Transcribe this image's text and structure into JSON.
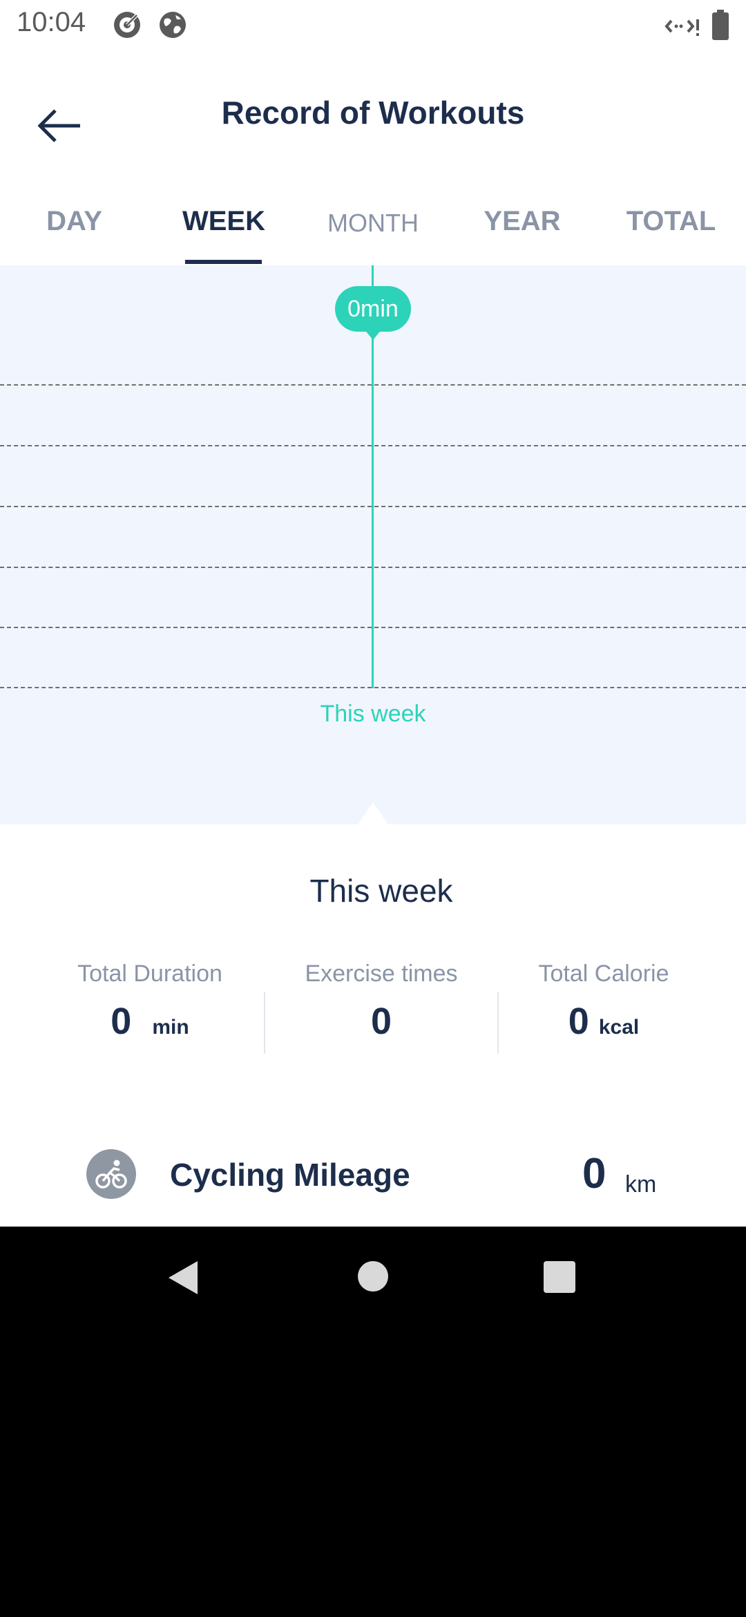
{
  "status_bar": {
    "time": "10:04",
    "icons": [
      "target-icon",
      "globe-icon",
      "data-saver-icon",
      "battery-icon"
    ]
  },
  "header": {
    "title": "Record of Workouts",
    "back_icon": "arrow-left-icon"
  },
  "tabs": [
    {
      "label": "DAY",
      "active": false
    },
    {
      "label": "WEEK",
      "active": true
    },
    {
      "label": "MONTH",
      "active": false
    },
    {
      "label": "YEAR",
      "active": false
    },
    {
      "label": "TOTAL",
      "active": false
    }
  ],
  "chart": {
    "tooltip": "0min",
    "x_label": "This week",
    "accent_color": "#2cd3b9"
  },
  "summary": {
    "period_title": "This week",
    "total_duration": {
      "label": "Total Duration",
      "value": "0",
      "unit": "min"
    },
    "exercise_times": {
      "label": "Exercise times",
      "value": "0"
    },
    "total_calorie": {
      "label": "Total Calorie",
      "value": "0",
      "unit": "kcal"
    }
  },
  "cycling": {
    "icon": "bicycle-icon",
    "label": "Cycling Mileage",
    "value": "0",
    "unit": "km"
  },
  "nav_bar": {
    "icons": [
      "back-triangle-icon",
      "home-circle-icon",
      "recents-square-icon"
    ]
  }
}
